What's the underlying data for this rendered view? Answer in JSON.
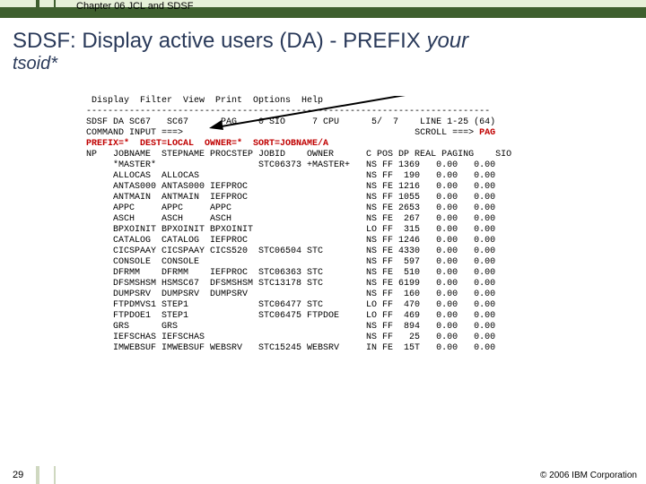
{
  "header": {
    "chapter": "Chapter 06 JCL and SDSF",
    "title_part1": "SDSF: Display active users (DA)  -   PREFIX ",
    "title_part2_italic": "your",
    "subtitle_italic": "tsoid*"
  },
  "sdsf": {
    "menu": "  Display  Filter  View  Print  Options  Help",
    "divider": " ---------------------------------------------------------------------------",
    "status_line": " SDSF DA SC67   SC67      PAG    0 SIO     7 CPU      5/  7    LINE 1-25 (64)",
    "cmd_line_left": " COMMAND INPUT ===>",
    "cmd_line_right_label": "SCROLL ===> ",
    "cmd_line_right_value": "PAG",
    "prefix_line": " PREFIX=*  DEST=LOCAL  OWNER=*  SORT=JOBNAME/A",
    "col_header": " NP   JOBNAME  STEPNAME PROCSTEP JOBID    OWNER      C POS DP REAL PAGING    SIO",
    "rows": [
      {
        "jobname": "*MASTER*",
        "stepname": "",
        "procstep": "",
        "jobid": "STC06373",
        "owner": "+MASTER+",
        "c": "",
        "pos": "NS",
        "dp": "FF",
        "real": "1369",
        "paging": "0.00",
        "sio": "0.00"
      },
      {
        "jobname": "ALLOCAS",
        "stepname": "ALLOCAS",
        "procstep": "",
        "jobid": "",
        "owner": "",
        "c": "",
        "pos": "NS",
        "dp": "FF",
        "real": "190",
        "paging": "0.00",
        "sio": "0.00"
      },
      {
        "jobname": "ANTAS000",
        "stepname": "ANTAS000",
        "procstep": "IEFPROC",
        "jobid": "",
        "owner": "",
        "c": "",
        "pos": "NS",
        "dp": "FE",
        "real": "1216",
        "paging": "0.00",
        "sio": "0.00"
      },
      {
        "jobname": "ANTMAIN",
        "stepname": "ANTMAIN",
        "procstep": "IEFPROC",
        "jobid": "",
        "owner": "",
        "c": "",
        "pos": "NS",
        "dp": "FF",
        "real": "1055",
        "paging": "0.00",
        "sio": "0.00"
      },
      {
        "jobname": "APPC",
        "stepname": "APPC",
        "procstep": "APPC",
        "jobid": "",
        "owner": "",
        "c": "",
        "pos": "NS",
        "dp": "FE",
        "real": "2653",
        "paging": "0.00",
        "sio": "0.00"
      },
      {
        "jobname": "ASCH",
        "stepname": "ASCH",
        "procstep": "ASCH",
        "jobid": "",
        "owner": "",
        "c": "",
        "pos": "NS",
        "dp": "FE",
        "real": "267",
        "paging": "0.00",
        "sio": "0.00"
      },
      {
        "jobname": "BPXOINIT",
        "stepname": "BPXOINIT",
        "procstep": "BPXOINIT",
        "jobid": "",
        "owner": "",
        "c": "",
        "pos": "LO",
        "dp": "FF",
        "real": "315",
        "paging": "0.00",
        "sio": "0.00"
      },
      {
        "jobname": "CATALOG",
        "stepname": "CATALOG",
        "procstep": "IEFPROC",
        "jobid": "",
        "owner": "",
        "c": "",
        "pos": "NS",
        "dp": "FF",
        "real": "1246",
        "paging": "0.00",
        "sio": "0.00"
      },
      {
        "jobname": "CICSPAAY",
        "stepname": "CICSPAAY",
        "procstep": "CICS520",
        "jobid": "STC06504",
        "owner": "STC",
        "c": "",
        "pos": "NS",
        "dp": "FE",
        "real": "4330",
        "paging": "0.00",
        "sio": "0.00"
      },
      {
        "jobname": "CONSOLE",
        "stepname": "CONSOLE",
        "procstep": "",
        "jobid": "",
        "owner": "",
        "c": "",
        "pos": "NS",
        "dp": "FF",
        "real": "597",
        "paging": "0.00",
        "sio": "0.00"
      },
      {
        "jobname": "DFRMM",
        "stepname": "DFRMM",
        "procstep": "IEFPROC",
        "jobid": "STC06363",
        "owner": "STC",
        "c": "",
        "pos": "NS",
        "dp": "FE",
        "real": "510",
        "paging": "0.00",
        "sio": "0.00"
      },
      {
        "jobname": "DFSMSHSM",
        "stepname": "HSMSC67",
        "procstep": "DFSMSHSM",
        "jobid": "STC13178",
        "owner": "STC",
        "c": "",
        "pos": "NS",
        "dp": "FE",
        "real": "6199",
        "paging": "0.00",
        "sio": "0.00"
      },
      {
        "jobname": "DUMPSRV",
        "stepname": "DUMPSRV",
        "procstep": "DUMPSRV",
        "jobid": "",
        "owner": "",
        "c": "",
        "pos": "NS",
        "dp": "FF",
        "real": "160",
        "paging": "0.00",
        "sio": "0.00"
      },
      {
        "jobname": "FTPDMVS1",
        "stepname": "STEP1",
        "procstep": "",
        "jobid": "STC06477",
        "owner": "STC",
        "c": "",
        "pos": "LO",
        "dp": "FF",
        "real": "470",
        "paging": "0.00",
        "sio": "0.00"
      },
      {
        "jobname": "FTPDOE1",
        "stepname": "STEP1",
        "procstep": "",
        "jobid": "STC06475",
        "owner": "FTPDOE",
        "c": "",
        "pos": "LO",
        "dp": "FF",
        "real": "469",
        "paging": "0.00",
        "sio": "0.00"
      },
      {
        "jobname": "GRS",
        "stepname": "GRS",
        "procstep": "",
        "jobid": "",
        "owner": "",
        "c": "",
        "pos": "NS",
        "dp": "FF",
        "real": "894",
        "paging": "0.00",
        "sio": "0.00"
      },
      {
        "jobname": "IEFSCHAS",
        "stepname": "IEFSCHAS",
        "procstep": "",
        "jobid": "",
        "owner": "",
        "c": "",
        "pos": "NS",
        "dp": "FF",
        "real": "25",
        "paging": "0.00",
        "sio": "0.00"
      },
      {
        "jobname": "IMWEBSUF",
        "stepname": "IMWEBSUF",
        "procstep": "WEBSRV",
        "jobid": "STC15245",
        "owner": "WEBSRV",
        "c": "",
        "pos": "IN",
        "dp": "FE",
        "real": "15T",
        "paging": "0.00",
        "sio": "0.00"
      }
    ]
  },
  "footer": {
    "page_number": "29",
    "copyright": "© 2006 IBM Corporation"
  }
}
